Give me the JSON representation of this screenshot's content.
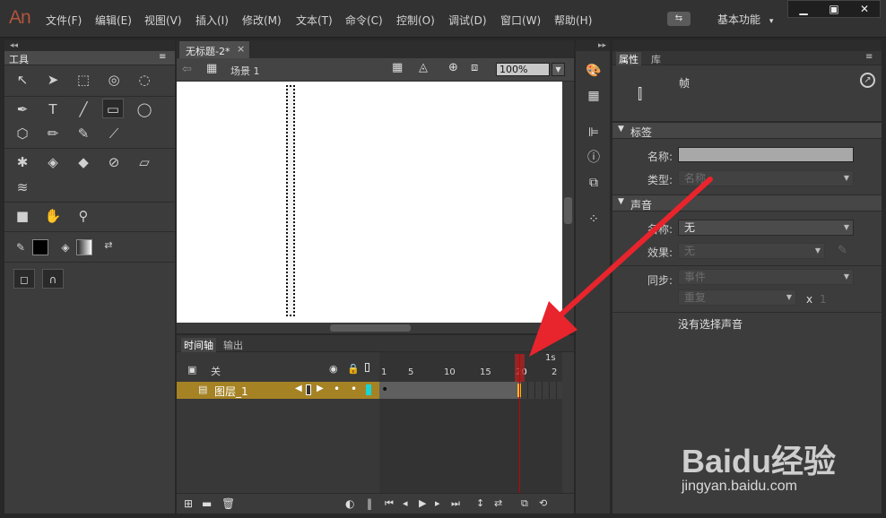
{
  "app": {
    "logo": "An"
  },
  "menu": [
    "文件(F)",
    "编辑(E)",
    "视图(V)",
    "插入(I)",
    "修改(M)",
    "文本(T)",
    "命令(C)",
    "控制(O)",
    "调试(D)",
    "窗口(W)",
    "帮助(H)"
  ],
  "workspace": {
    "label": "基本功能",
    "arrow": "▾",
    "sync_glyph": "⇆"
  },
  "window_controls": {
    "minimize": "▁",
    "restore": "▣",
    "close": "✕"
  },
  "collapse_glyph": "◂◂",
  "expand_glyph": "▸▸",
  "tools": {
    "title": "工具",
    "glyphs": {
      "selection": "↖",
      "subselection": "➤",
      "free-transform": "⬚",
      "3d-rotation": "◎",
      "lasso": "◌",
      "pen": "✒",
      "text": "T",
      "line": "╱",
      "rectangle": "▭",
      "oval": "◯",
      "polystar": "⬡",
      "pencil": "✏",
      "brush": "✎",
      "paint-brush": "⟋",
      "bone": "✱",
      "paint-bucket": "◈",
      "ink-bottle": "◆",
      "eyedropper": "⊘",
      "eraser": "▱",
      "width": "≋",
      "camera": "■",
      "hand": "✋",
      "zoom": "⚲",
      "stroke-color": "✎",
      "fill-color": "◈",
      "swap": "⇄",
      "object-draw": "◻",
      "snap": "∩"
    }
  },
  "document": {
    "tab_title": "无标题-2*",
    "close_glyph": "×",
    "scene_label": "场景 1",
    "back_glyph": "⇦",
    "clapper_glyph": "▦",
    "zoom": "100%"
  },
  "timeline": {
    "tabs": [
      "时间轴",
      "输出"
    ],
    "header_label": "关",
    "col_eye": "👁",
    "col_lock": "🔒",
    "layer_name": "图层_1",
    "ruler": [
      "1",
      "5",
      "10",
      "15",
      "20",
      "2"
    ],
    "seconds_label": "1s",
    "footer_glyphs": [
      "⊞",
      "▬",
      "🗑",
      "◐",
      "‖",
      "⏮",
      "◂",
      "▶",
      "▸",
      "⏭",
      "↕",
      "⇄",
      "⧉",
      "⟲"
    ]
  },
  "side_icons": [
    "palette",
    "grid",
    "align",
    "info",
    "transform",
    "dots"
  ],
  "properties": {
    "tabs": [
      "属性",
      "库"
    ],
    "frame_label": "帧",
    "label_section": "标签",
    "name_label": "名称:",
    "type_label": "类型:",
    "type_value": "名称",
    "sound_section": "声音",
    "sound_name_label": "名称:",
    "sound_name_value": "无",
    "effect_label": "效果:",
    "effect_value": "无",
    "sync_label": "同步:",
    "sync_value": "事件",
    "repeat_value": "重复",
    "times_x": "x",
    "times_value": "1",
    "no_sound": "没有选择声音"
  },
  "watermark": {
    "brand": "Baidu经验",
    "url": "jingyan.baidu.com"
  },
  "colors": {
    "accent_arrow": "#e8242c",
    "layer_selected": "#a58324",
    "logo": "#b0553e"
  }
}
